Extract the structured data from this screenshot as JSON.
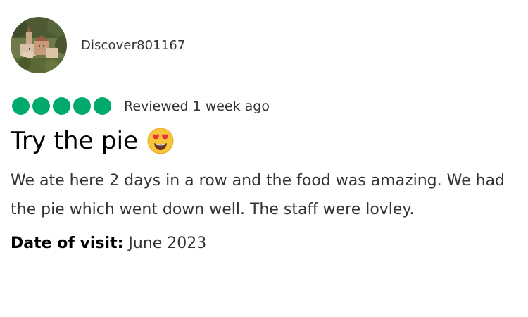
{
  "review": {
    "username": "Discover801167",
    "avatar_icon": "village-photo-avatar",
    "rating": 5,
    "rating_max": 5,
    "rating_color": "#00aa6c",
    "reviewed_text": "Reviewed 1 week ago",
    "title": "Try the pie",
    "title_emoji": "heart-eyes-emoji",
    "body": "We ate here 2 days in a row and the food was amazing. We had the pie which went down well. The staff were lovley.",
    "date_of_visit_label": "Date of visit:",
    "date_of_visit_value": "June 2023"
  }
}
